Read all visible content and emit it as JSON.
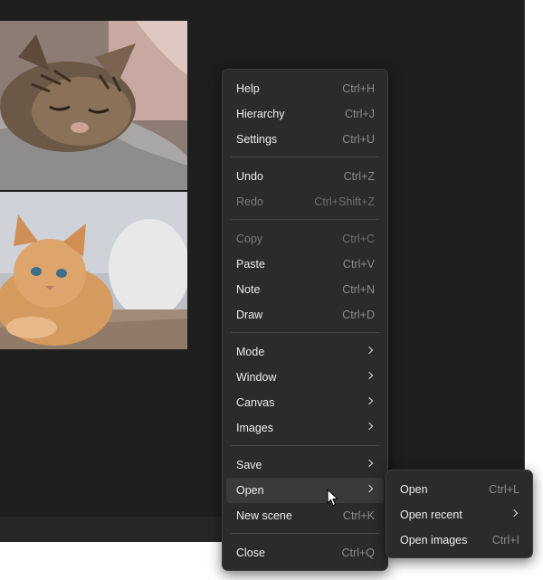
{
  "main_menu": {
    "groups": [
      [
        {
          "label": "Help",
          "shortcut": "Ctrl+H",
          "enabled": true
        },
        {
          "label": "Hierarchy",
          "shortcut": "Ctrl+J",
          "enabled": true
        },
        {
          "label": "Settings",
          "shortcut": "Ctrl+U",
          "enabled": true
        }
      ],
      [
        {
          "label": "Undo",
          "shortcut": "Ctrl+Z",
          "enabled": true
        },
        {
          "label": "Redo",
          "shortcut": "Ctrl+Shift+Z",
          "enabled": false
        }
      ],
      [
        {
          "label": "Copy",
          "shortcut": "Ctrl+C",
          "enabled": false
        },
        {
          "label": "Paste",
          "shortcut": "Ctrl+V",
          "enabled": true
        },
        {
          "label": "Note",
          "shortcut": "Ctrl+N",
          "enabled": true
        },
        {
          "label": "Draw",
          "shortcut": "Ctrl+D",
          "enabled": true
        }
      ],
      [
        {
          "label": "Mode",
          "submenu": true,
          "enabled": true
        },
        {
          "label": "Window",
          "submenu": true,
          "enabled": true
        },
        {
          "label": "Canvas",
          "submenu": true,
          "enabled": true
        },
        {
          "label": "Images",
          "submenu": true,
          "enabled": true
        }
      ],
      [
        {
          "label": "Save",
          "submenu": true,
          "enabled": true
        },
        {
          "label": "Open",
          "submenu": true,
          "enabled": true,
          "highlighted": true
        },
        {
          "label": "New scene",
          "shortcut": "Ctrl+K",
          "enabled": true
        }
      ],
      [
        {
          "label": "Close",
          "shortcut": "Ctrl+Q",
          "enabled": true
        }
      ]
    ]
  },
  "open_submenu": {
    "items": [
      {
        "label": "Open",
        "shortcut": "Ctrl+L"
      },
      {
        "label": "Open recent",
        "submenu": true
      },
      {
        "label": "Open images",
        "shortcut": "Ctrl+I"
      }
    ]
  },
  "images": [
    {
      "subject": "tabby cat sleeping on grey blanket"
    },
    {
      "subject": "ginger kitten lying down"
    }
  ],
  "colors": {
    "canvas_bg": "#1e1e1e",
    "menu_bg": "#2b2b2b",
    "highlight": "#3a3a3a",
    "text": "#ececec",
    "shortcut_text": "#8c8c8c",
    "disabled_text": "#7a7a7a"
  }
}
